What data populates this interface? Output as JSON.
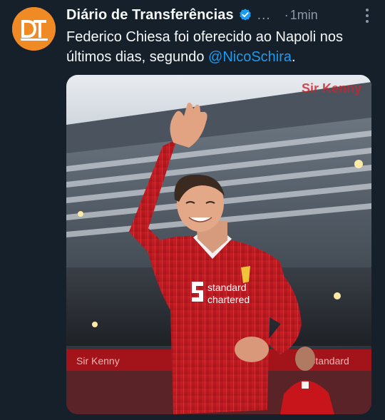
{
  "author": {
    "display_name": "Diário de Transferências",
    "avatar_initials": "DT",
    "verified": true,
    "handle_truncated": "…",
    "avatar_color": "#f08a24"
  },
  "meta": {
    "separator": "·",
    "time": "1min"
  },
  "tweet": {
    "text_before": "Federico Chiesa foi oferecido ao Napoli nos últimos dias, segundo ",
    "mention": "@NicoSchira",
    "text_after": "."
  },
  "media": {
    "sponsor_line1": "standard",
    "sponsor_line2": "chartered",
    "stand_banner": "Sir Kenny",
    "board_left": "Sir Kenny",
    "board_right": "Standard"
  },
  "colors": {
    "background": "#15202b",
    "link": "#1d9bf0",
    "muted": "#8b98a5",
    "verified": "#1d9bf0"
  }
}
